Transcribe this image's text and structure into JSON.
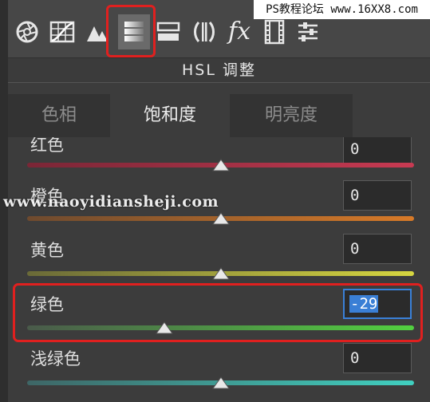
{
  "watermark_top": "PS教程论坛 www.16XX8.com",
  "watermark_mid": "www.naoyidiansheji.com",
  "toolbar": {
    "tools": [
      {
        "icon": "aperture-icon"
      },
      {
        "icon": "tone-curve-grid-icon"
      },
      {
        "icon": "mountains-icon"
      },
      {
        "icon": "hsl-gradient-icon",
        "active": true
      },
      {
        "icon": "split-toning-icon"
      },
      {
        "icon": "lens-correction-icon"
      },
      {
        "icon": "fx-effects-icon"
      },
      {
        "icon": "filmstrip-calibration-icon"
      },
      {
        "icon": "presets-sliders-icon"
      }
    ],
    "fx_label": "fx"
  },
  "panel": {
    "title": "HSL 调整"
  },
  "tabs": [
    {
      "label": "色相",
      "active": false
    },
    {
      "label": "饱和度",
      "active": true
    },
    {
      "label": "明亮度",
      "active": false
    }
  ],
  "sliders": [
    {
      "label": "红色",
      "value": "0",
      "level": 0.5,
      "gradient": [
        "#7a2636",
        "#c83a52"
      ]
    },
    {
      "label": "橙色",
      "value": "0",
      "level": 0.5,
      "gradient": [
        "#6e4a2e",
        "#d87a28"
      ]
    },
    {
      "label": "黄色",
      "value": "0",
      "level": 0.5,
      "gradient": [
        "#6a6a38",
        "#d6d640"
      ]
    },
    {
      "label": "绿色",
      "value": "-29",
      "level": 0.355,
      "gradient": [
        "#4a5a4a",
        "#52d040"
      ]
    },
    {
      "label": "浅绿色",
      "value": "0",
      "level": 0.5,
      "gradient": [
        "#3e6666",
        "#40d0c0"
      ]
    }
  ],
  "colors": {
    "highlight": "#e0201f",
    "focus": "#3a80d8"
  }
}
